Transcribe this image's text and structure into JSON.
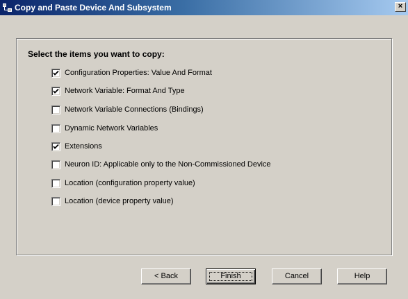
{
  "window": {
    "title": "Copy and Paste Device And Subsystem",
    "close_glyph": "×",
    "icon": "copy-subsystem-icon"
  },
  "heading": "Select the items you want to copy:",
  "items": [
    {
      "label": "Configuration Properties: Value And Format",
      "checked": true
    },
    {
      "label": "Network Variable: Format And Type",
      "checked": true
    },
    {
      "label": "Network Variable Connections (Bindings)",
      "checked": false
    },
    {
      "label": "Dynamic Network Variables",
      "checked": false
    },
    {
      "label": "Extensions",
      "checked": true
    },
    {
      "label": "Neuron ID: Applicable only to the Non-Commissioned Device",
      "checked": false
    },
    {
      "label": "Location (configuration property value)",
      "checked": false
    },
    {
      "label": "Location (device property value)",
      "checked": false
    }
  ],
  "buttons": {
    "back": "< Back",
    "finish": "Finish",
    "cancel": "Cancel",
    "help": "Help"
  },
  "colors": {
    "titlebar_start": "#0a246a",
    "titlebar_end": "#a6caf0",
    "face": "#d4d0c8"
  }
}
